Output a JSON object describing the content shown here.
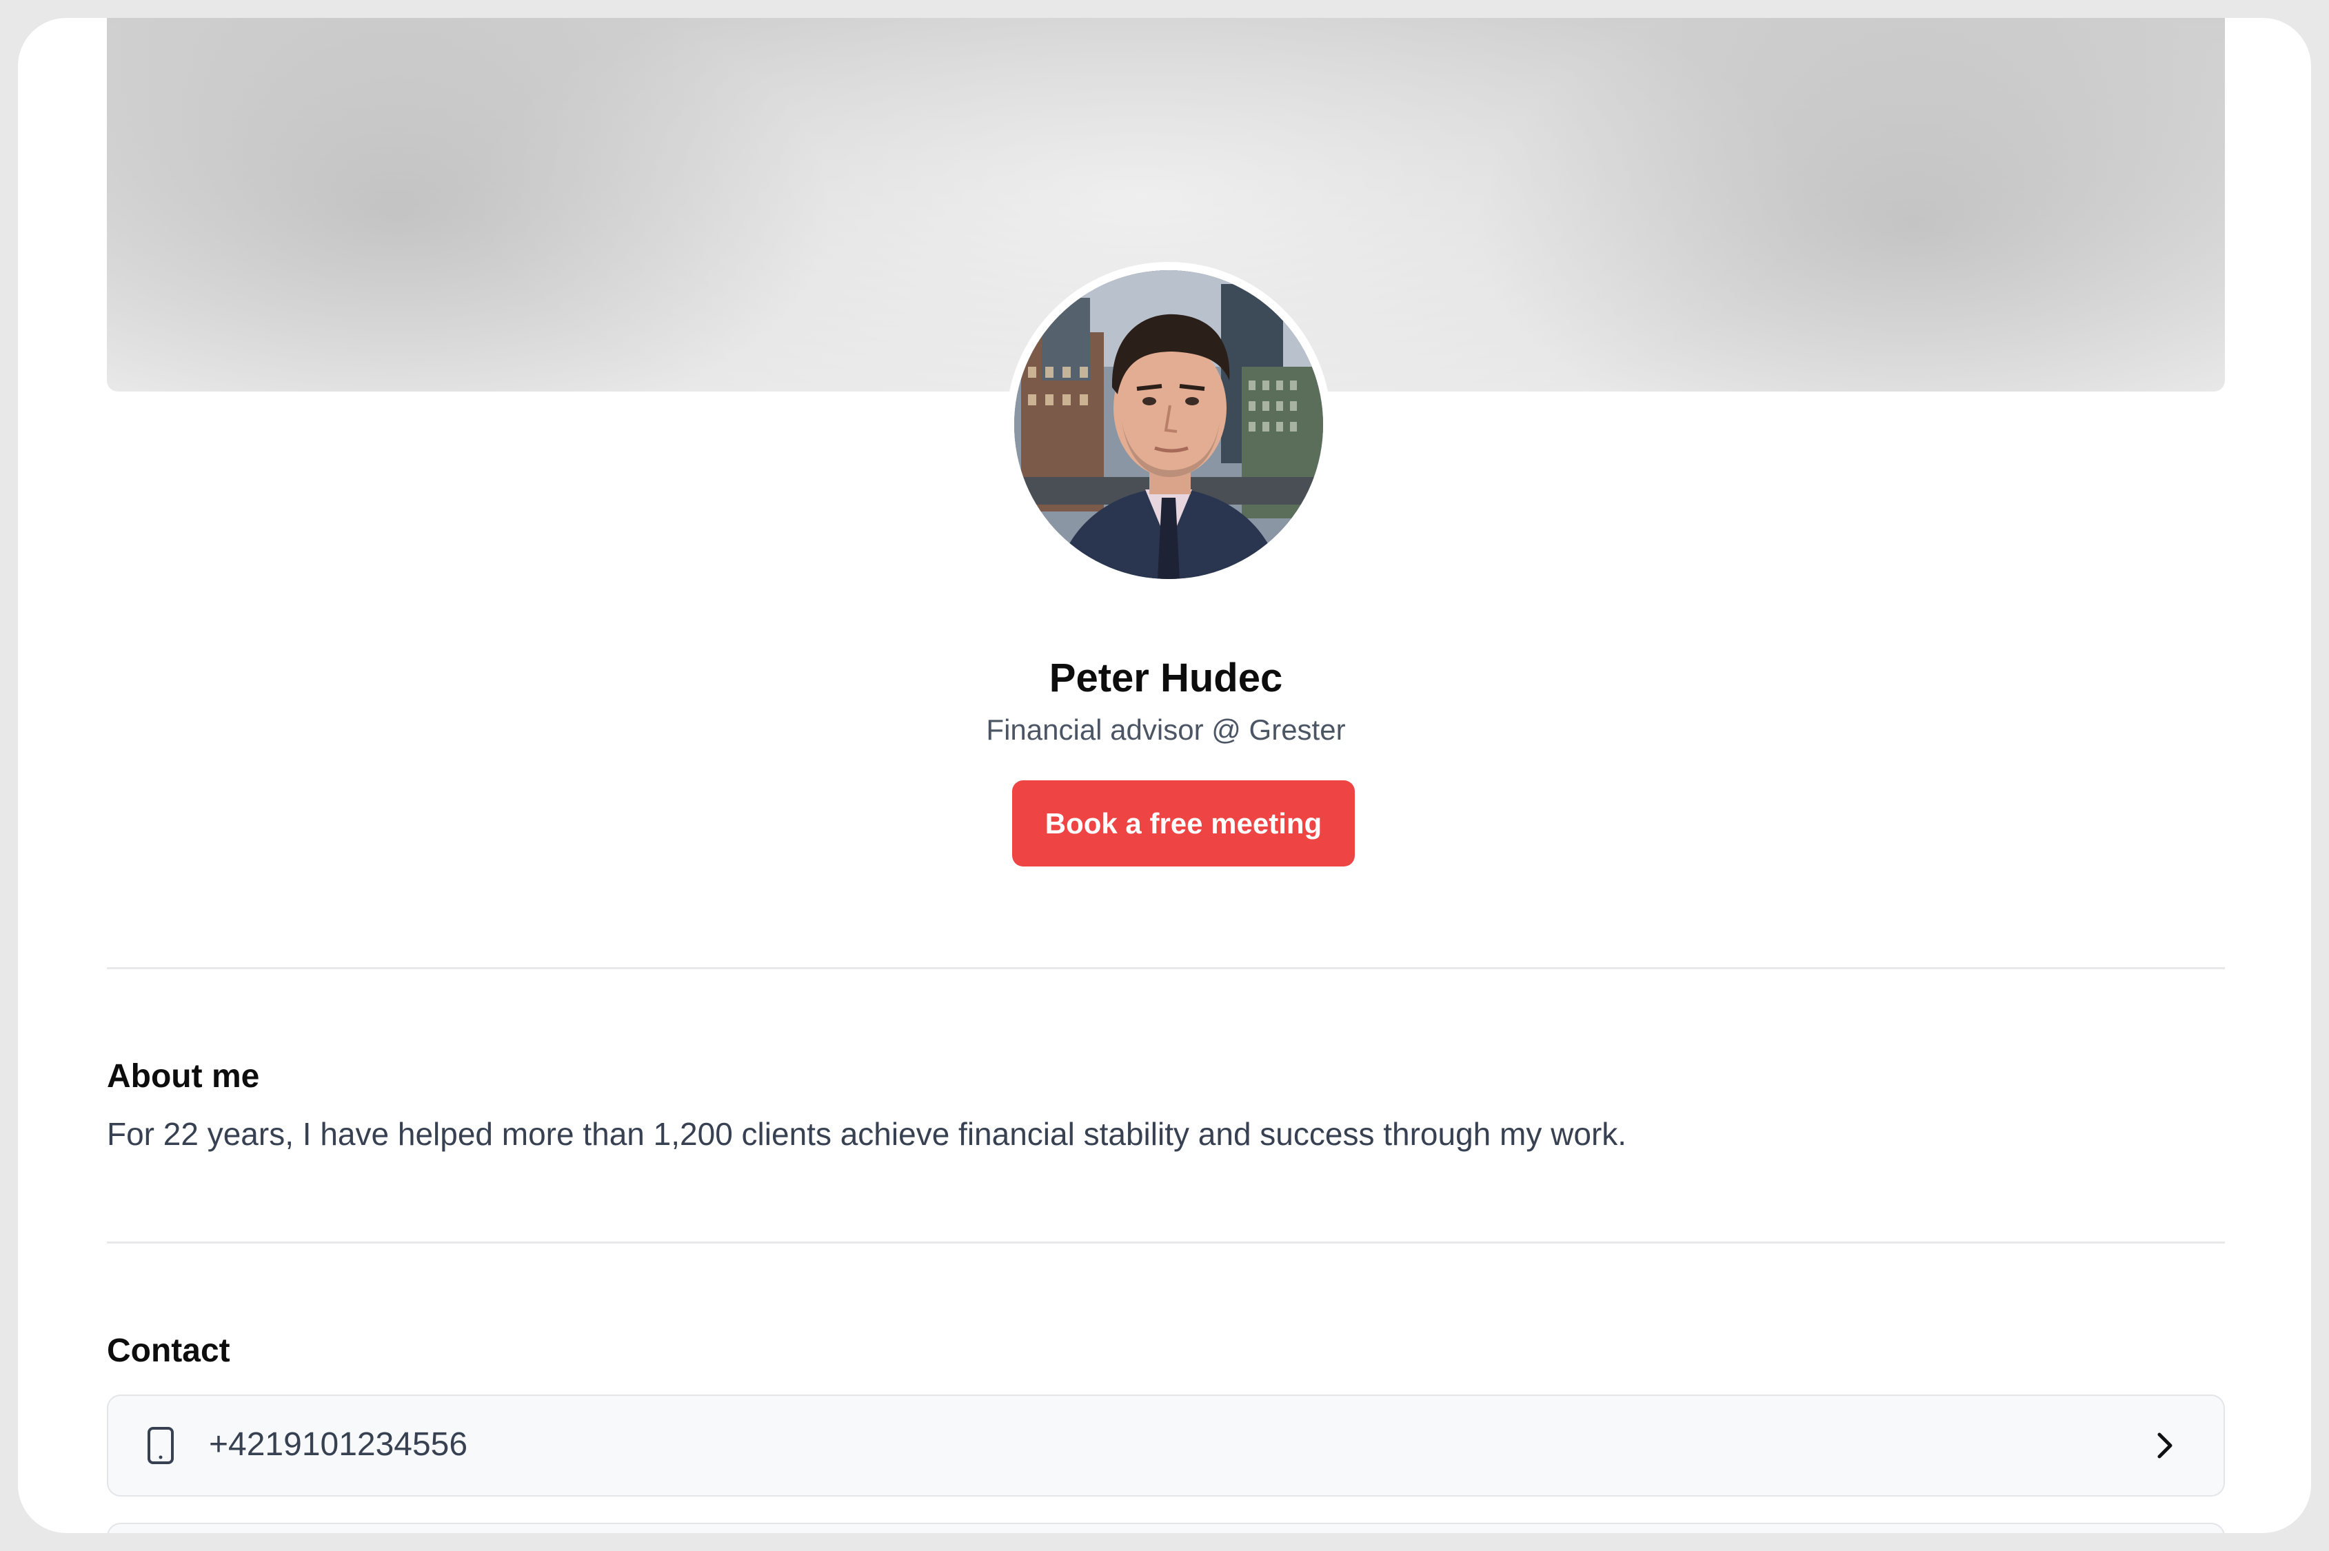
{
  "profile": {
    "name": "Peter Hudec",
    "subtitle": "Financial advisor @ Grester",
    "cta_label": "Book a free meeting"
  },
  "about": {
    "heading": "About me",
    "text": "For 22 years, I have helped more than 1,200 clients achieve financial stability and success through my work."
  },
  "contact": {
    "heading": "Contact",
    "items": [
      {
        "icon": "phone-icon",
        "value": "+4219101234556"
      },
      {
        "icon": "unknown",
        "value": ""
      }
    ]
  },
  "colors": {
    "accent": "#ef4444",
    "text_primary": "#0d0d0d",
    "text_secondary": "#4b5563",
    "row_background": "#f8f9fa"
  }
}
